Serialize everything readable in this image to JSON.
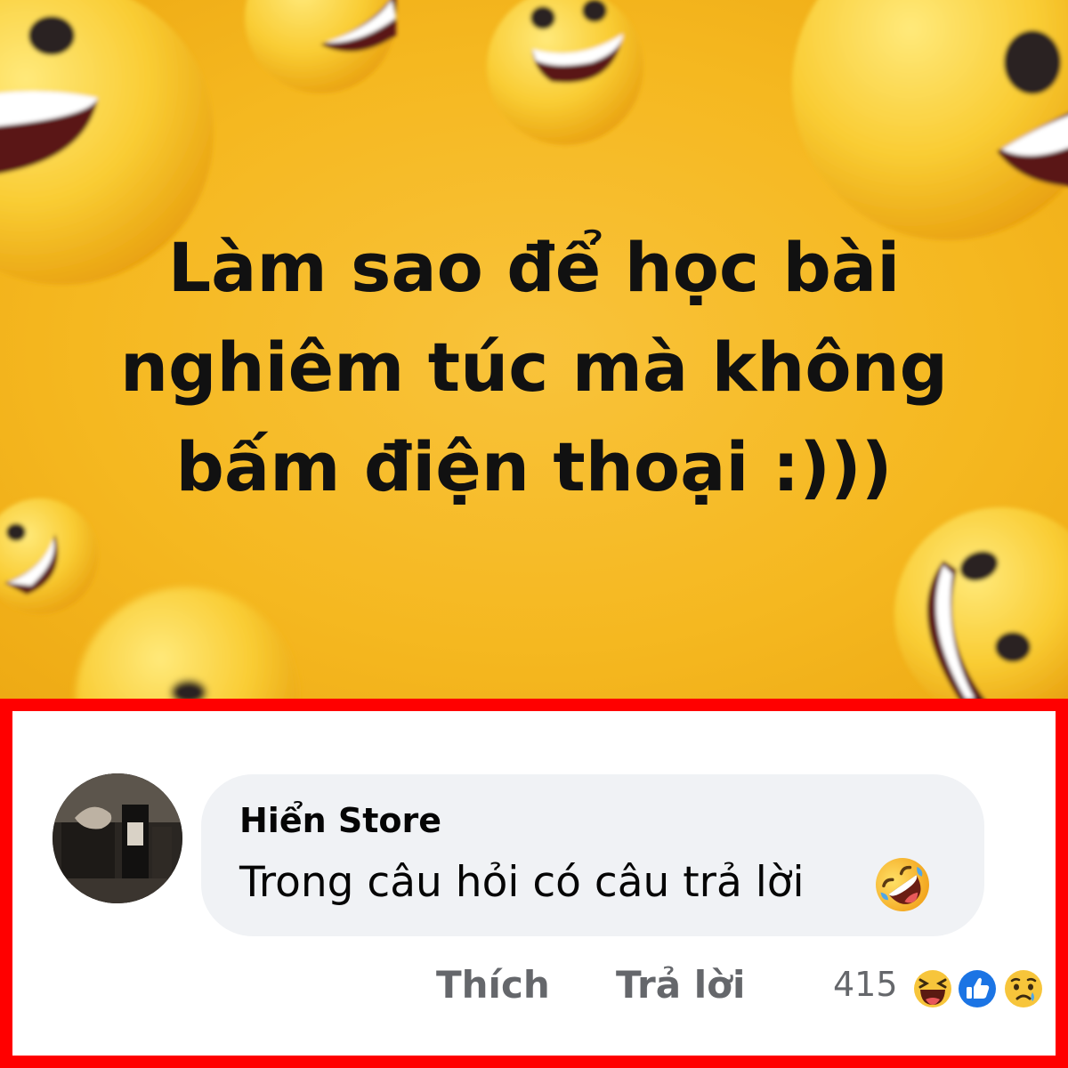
{
  "post": {
    "caption_lines": [
      "Làm sao để học bài",
      "nghiêm túc mà không",
      "bấm điện thoại :)))"
    ],
    "background_color": "#f5b820",
    "decoration": "laughing-emoji"
  },
  "comment": {
    "author": "Hiển Store",
    "text": "Trong câu hỏi có câu trả lời",
    "text_emoji": "rolling-on-floor-laughing-emoji",
    "actions": {
      "like_label": "Thích",
      "reply_label": "Trả lời"
    },
    "reactions": {
      "count": "415",
      "types": [
        "haha-reaction-icon",
        "like-reaction-icon",
        "sad-reaction-icon"
      ]
    },
    "frame_color": "#ff0000",
    "bubble_color": "#f0f2f5"
  }
}
